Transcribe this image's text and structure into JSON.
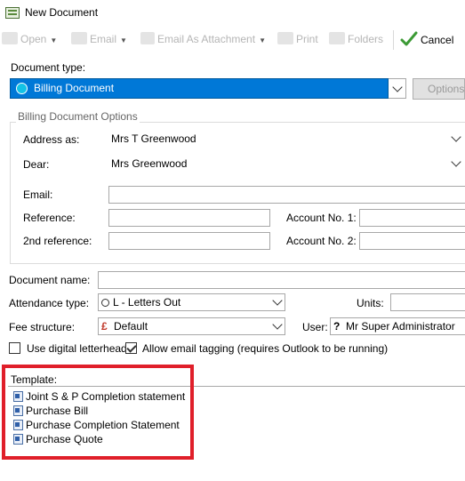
{
  "window": {
    "title": "New Document"
  },
  "toolbar": {
    "open": "Open",
    "email": "Email",
    "email_attachment": "Email As Attachment",
    "print": "Print",
    "folders": "Folders",
    "cancel": "Cancel"
  },
  "doc_type": {
    "label": "Document type:",
    "value": "Billing Document",
    "options_button": "Options..."
  },
  "billing": {
    "group_title": "Billing Document Options",
    "address_as_label": "Address as:",
    "address_as_value": "Mrs T Greenwood",
    "dear_label": "Dear:",
    "dear_value": "Mrs Greenwood",
    "email_label": "Email:",
    "email_value": "",
    "reference_label": "Reference:",
    "reference_value": "",
    "second_reference_label": "2nd reference:",
    "second_reference_value": "",
    "account1_label": "Account No. 1:",
    "account1_value": "",
    "account2_label": "Account No. 2:",
    "account2_value": ""
  },
  "document": {
    "name_label": "Document name:",
    "name_value": "",
    "attendance_label": "Attendance type:",
    "attendance_value": "L - Letters Out",
    "units_label": "Units:",
    "units_value": "",
    "fee_label": "Fee structure:",
    "fee_value": "Default",
    "user_label": "User:",
    "user_value": "Mr Super Administrator"
  },
  "options": {
    "digital_letterhead": {
      "label": "Use digital letterhead",
      "checked": false
    },
    "email_tagging": {
      "label": "Allow email tagging (requires Outlook to be running)",
      "checked": true
    }
  },
  "template": {
    "label": "Template:",
    "items": [
      "Joint S & P Completion statement",
      "Purchase Bill",
      "Purchase Completion Statement",
      "Purchase Quote"
    ]
  },
  "colors": {
    "selection": "#0078d7",
    "highlight_border": "#e01f2a",
    "cancel_icon": "#3c9a35"
  }
}
